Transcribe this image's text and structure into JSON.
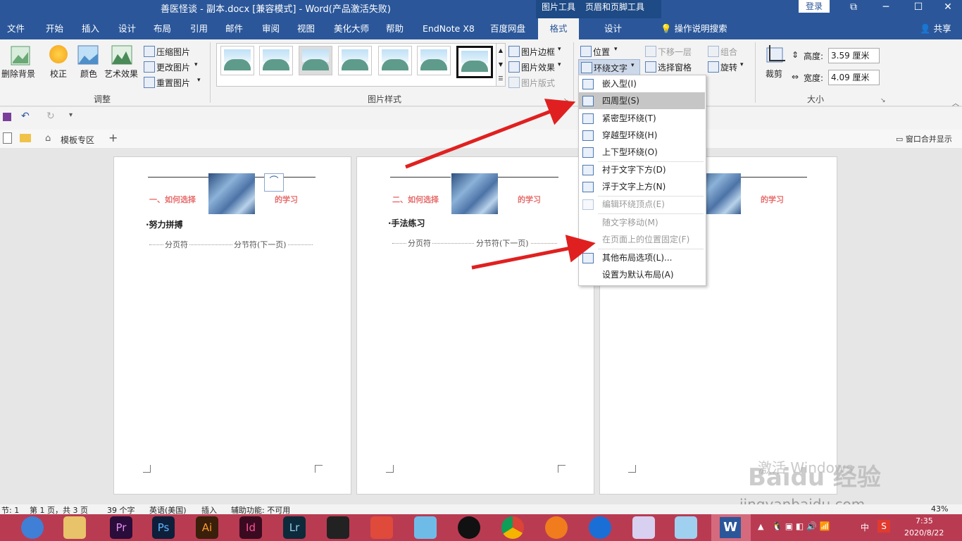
{
  "titlebar": {
    "title": "善医怪谈 - 副本.docx [兼容模式] - Word(产品激活失败)",
    "ctx_picture_tools": "图片工具",
    "ctx_header_footer_tools": "页眉和页脚工具",
    "login": "登录",
    "restore_icon": "⧉",
    "minimize_icon": "─",
    "maximize_icon": "☐",
    "close_icon": "✕"
  },
  "tabs": [
    "文件",
    "开始",
    "插入",
    "设计",
    "布局",
    "引用",
    "邮件",
    "审阅",
    "视图",
    "美化大师",
    "帮助",
    "EndNote X8",
    "百度网盘",
    "格式",
    "设计"
  ],
  "tellme": "操作说明搜索",
  "share": "共享",
  "ribbon": {
    "remove_bg": "删除背景",
    "correct": "校正",
    "color": "颜色",
    "art_effects": "艺术效果",
    "compress": "压缩图片",
    "change": "更改图片",
    "reset": "重置图片",
    "group_adjust": "调整",
    "group_styles": "图片样式",
    "border": "图片边框",
    "effects": "图片效果",
    "layout": "图片版式",
    "position": "位置",
    "wrap_text": "环绕文字",
    "send_back": "下移一层",
    "selection_pane": "选择窗格",
    "group": "组合",
    "rotate": "旋转",
    "crop": "裁剪",
    "height_label": "高度:",
    "height_value": "3.59 厘米",
    "width_label": "宽度:",
    "width_value": "4.09 厘米",
    "group_size": "大小"
  },
  "doctabs": {
    "template": "模板专区",
    "merge": "窗口合并显示"
  },
  "pages": [
    {
      "heading_left": "一、如何选择",
      "heading_right": "的学习",
      "body": "·努力拼搏",
      "breaks": "分页符",
      "section_break": "分节符(下一页)"
    },
    {
      "heading_left": "二、如何选择",
      "heading_right": "的学习",
      "body": "·手法练习",
      "breaks": "分页符",
      "section_break": "分节符(下一页)"
    },
    {
      "heading_right": "的学习"
    }
  ],
  "wrap_menu": [
    {
      "label": "嵌入型(I)",
      "disabled": false,
      "selected": false
    },
    {
      "label": "四周型(S)",
      "disabled": false,
      "selected": true
    },
    {
      "label": "紧密型环绕(T)",
      "disabled": false,
      "selected": false
    },
    {
      "label": "穿越型环绕(H)",
      "disabled": false,
      "selected": false
    },
    {
      "label": "上下型环绕(O)",
      "disabled": false,
      "selected": false
    },
    {
      "label": "衬于文字下方(D)",
      "disabled": false,
      "selected": false
    },
    {
      "label": "浮于文字上方(N)",
      "disabled": false,
      "selected": false
    },
    {
      "label": "编辑环绕顶点(E)",
      "disabled": true,
      "selected": false
    },
    {
      "label": "随文字移动(M)",
      "disabled": true,
      "selected": false
    },
    {
      "label": "在页面上的位置固定(F)",
      "disabled": true,
      "selected": false
    },
    {
      "label": "其他布局选项(L)...",
      "disabled": false,
      "selected": false
    },
    {
      "label": "设置为默认布局(A)",
      "disabled": false,
      "selected": false
    }
  ],
  "status": {
    "section": "节: 1",
    "page": "第 1 页，共 3 页",
    "words": "39 个字",
    "lang": "英语(美国)",
    "mode": "插入",
    "accessibility": "辅助功能: 不可用",
    "zoom": "43%"
  },
  "watermark": {
    "activate": "激活 Windows",
    "site": "jingyanbaidu.com",
    "brand": "Baidu 经验"
  },
  "taskbar": {
    "apps": [
      "Pr",
      "Ps",
      "Ai",
      "Id",
      "Lr"
    ],
    "time": "7:35",
    "date": "2020/8/22",
    "ime": "中"
  },
  "colors": {
    "accent": "#2b579a",
    "taskbar": "#b93b52",
    "heading_red": "#e86d6d",
    "arrow_red": "#e02020"
  }
}
